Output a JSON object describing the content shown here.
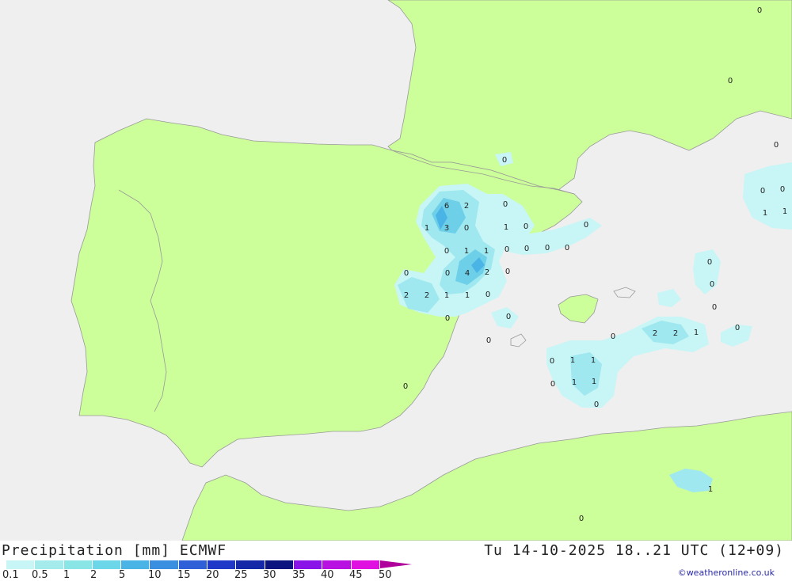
{
  "footer": {
    "title_left": "Precipitation [mm] ECMWF",
    "title_right": "Tu 14-10-2025 18..21 UTC (12+09)",
    "credit": "©weatheronline.co.uk"
  },
  "legend": {
    "labels": [
      "0.1",
      "0.5",
      "1",
      "2",
      "5",
      "10",
      "15",
      "20",
      "25",
      "30",
      "35",
      "40",
      "45",
      "50"
    ],
    "colors": [
      "#c8f5f5",
      "#a6ebeb",
      "#8ae6e6",
      "#6dd7ea",
      "#4ab4e6",
      "#3a8fe0",
      "#3060d8",
      "#2038c8",
      "#1428a8",
      "#0c1480",
      "#8a14e8",
      "#b810e0",
      "#e010e0",
      "#c010c0",
      "#b0009c"
    ]
  },
  "map": {
    "colors": {
      "sea": "#efefef",
      "land": "#ccff99",
      "border": "#999999",
      "precip_light": "#c8f5f5",
      "precip_mid": "#9fe8f0",
      "precip_strong": "#6dcfe8",
      "precip_core": "#4ab4e6"
    },
    "values": [
      {
        "t": "0"
      },
      {
        "t": "0"
      },
      {
        "t": "0"
      },
      {
        "t": "0"
      },
      {
        "t": "0"
      },
      {
        "t": "0"
      },
      {
        "t": "1"
      },
      {
        "t": "1"
      },
      {
        "t": "6"
      },
      {
        "t": "2"
      },
      {
        "t": "0"
      },
      {
        "t": "1"
      },
      {
        "t": "3"
      },
      {
        "t": "0"
      },
      {
        "t": "1"
      },
      {
        "t": "0"
      },
      {
        "t": "0"
      },
      {
        "t": "0"
      },
      {
        "t": "1"
      },
      {
        "t": "1"
      },
      {
        "t": "0"
      },
      {
        "t": "0"
      },
      {
        "t": "0"
      },
      {
        "t": "0"
      },
      {
        "t": "0"
      },
      {
        "t": "0"
      },
      {
        "t": "4"
      },
      {
        "t": "2"
      },
      {
        "t": "0"
      },
      {
        "t": "2"
      },
      {
        "t": "2"
      },
      {
        "t": "1"
      },
      {
        "t": "1"
      },
      {
        "t": "0"
      },
      {
        "t": "0"
      },
      {
        "t": "0"
      },
      {
        "t": "0"
      },
      {
        "t": "0"
      },
      {
        "t": "0"
      },
      {
        "t": "2"
      },
      {
        "t": "2"
      },
      {
        "t": "1"
      },
      {
        "t": "0"
      },
      {
        "t": "0"
      },
      {
        "t": "0"
      },
      {
        "t": "1"
      },
      {
        "t": "1"
      },
      {
        "t": "0"
      },
      {
        "t": "1"
      },
      {
        "t": "1"
      },
      {
        "t": "0"
      },
      {
        "t": "0"
      },
      {
        "t": "1"
      },
      {
        "t": "0"
      },
      {
        "t": "0"
      }
    ]
  }
}
